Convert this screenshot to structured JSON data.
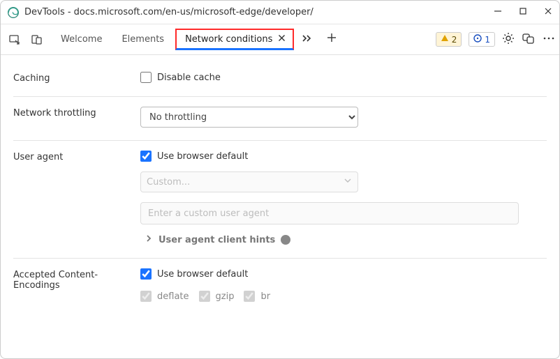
{
  "window": {
    "title": "DevTools - docs.microsoft.com/en-us/microsoft-edge/developer/"
  },
  "tabs": {
    "welcome": "Welcome",
    "elements": "Elements",
    "network_conditions": "Network conditions"
  },
  "badges": {
    "warnings": "2",
    "info": "1"
  },
  "caching": {
    "label": "Caching",
    "disable_cache": "Disable cache"
  },
  "throttling": {
    "label": "Network throttling",
    "selected": "No throttling"
  },
  "user_agent": {
    "label": "User agent",
    "use_default": "Use browser default",
    "custom_placeholder": "Custom...",
    "custom_input_placeholder": "Enter a custom user agent",
    "client_hints_label": "User agent client hints"
  },
  "encodings": {
    "label": "Accepted Content-Encodings",
    "use_default": "Use browser default",
    "deflate": "deflate",
    "gzip": "gzip",
    "br": "br"
  }
}
